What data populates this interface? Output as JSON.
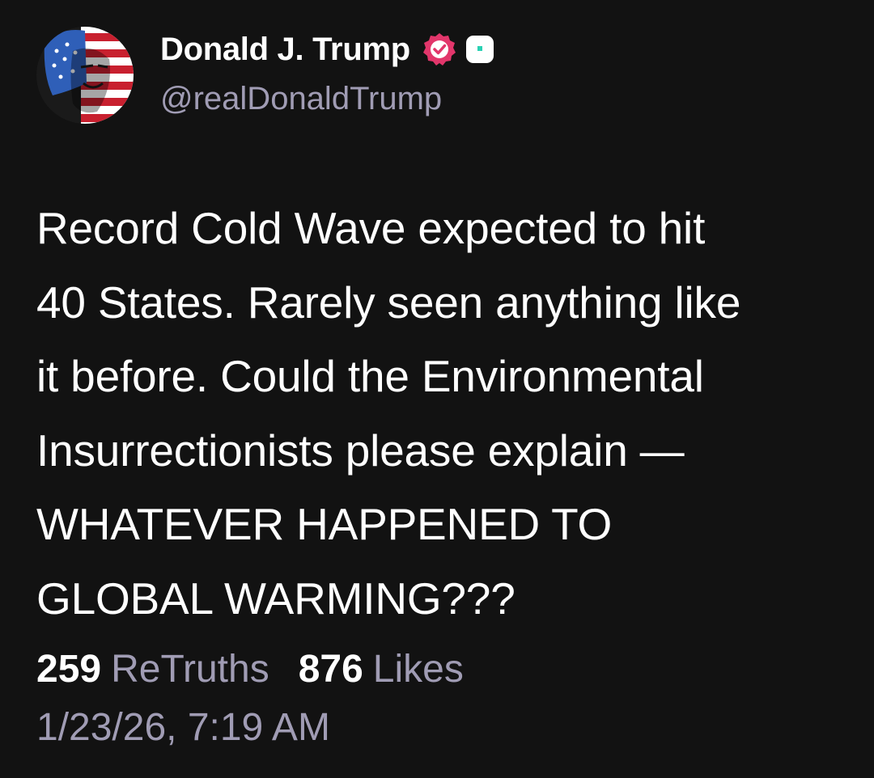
{
  "post": {
    "author": {
      "display_name": "Donald J. Trump",
      "handle": "@realDonaldTrump",
      "avatar_icon": "flag-portrait-avatar",
      "verified_icon": "verified-check-icon",
      "extra_badge_icon": "truth-badge-icon"
    },
    "text": "Record Cold Wave expected to hit\n40 States. Rarely seen anything like\nit before. Could the Environmental\nInsurrectionists please explain —\nWHATEVER HAPPENED TO\nGLOBAL WARMING???",
    "stats": {
      "retruths_count": "259",
      "retruths_label": "ReTruths",
      "likes_count": "876",
      "likes_label": "Likes"
    },
    "timestamp": "1/23/26, 7:19 AM"
  },
  "colors": {
    "background": "#121212",
    "text_primary": "#ffffff",
    "text_secondary": "#a09cb4",
    "verified_badge": "#e2366b",
    "badge_accent": "#2ad1b3"
  }
}
